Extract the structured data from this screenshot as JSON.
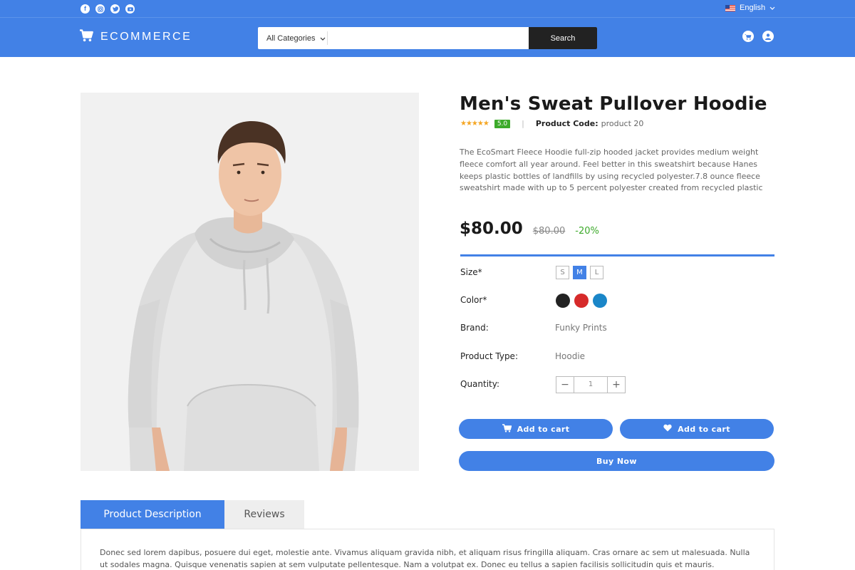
{
  "topbar": {
    "social_icons": [
      "facebook-icon",
      "instagram-icon",
      "twitter-icon",
      "youtube-icon"
    ],
    "language": "English"
  },
  "header": {
    "logo": "ECOMMERCE",
    "search": {
      "category": "All Categories",
      "placeholder": "",
      "button": "Search"
    },
    "icons": [
      "cart-icon",
      "user-icon"
    ]
  },
  "product": {
    "title": "Men's Sweat Pullover Hoodie",
    "stars": 5,
    "rating": "5.0",
    "code_label": "Product Code:",
    "code": "product 20",
    "description": "The EcoSmart Fleece Hoodie full-zip hooded jacket provides medium weight fleece comfort all year around. Feel better in this sweatshirt because Hanes keeps plastic bottles of landfills by using recycled polyester.7.8 ounce fleece sweatshirt made with up to 5 percent polyester created from recycled plastic",
    "price": "$80.00",
    "old_price": "$80.00",
    "discount": "-20%",
    "size_label": "Size*",
    "sizes": [
      "S",
      "M",
      "L"
    ],
    "selected_size": "M",
    "color_label": "Color*",
    "colors": [
      "#222222",
      "#d62a2a",
      "#1a86c8"
    ],
    "brand_label": "Brand:",
    "brand": "Funky Prints",
    "type_label": "Product Type:",
    "type": "Hoodie",
    "quantity_label": "Quantity:",
    "quantity": "1"
  },
  "actions": {
    "add_to_cart": "Add to cart",
    "wishlist_add": "Add to cart",
    "buy_now": "Buy Now"
  },
  "tabs": {
    "description": "Product Description",
    "reviews": "Reviews",
    "content": "Donec sed lorem dapibus, posuere dui eget, molestie ante. Vivamus aliquam gravida nibh, et aliquam risus fringilla aliquam. Cras ornare ac sem ut malesuada. Nulla ut sodales magna. Quisque venenatis sapien at sem vulputate pellentesque. Nam a volutpat ex. Donec eu tellus a sapien facilisis sollicitudin quis et mauris. Vestibulum ac"
  },
  "colors": {
    "brand_blue": "#4281e6",
    "dark": "#222222",
    "green": "#3caa2a",
    "star": "#f5a623"
  }
}
